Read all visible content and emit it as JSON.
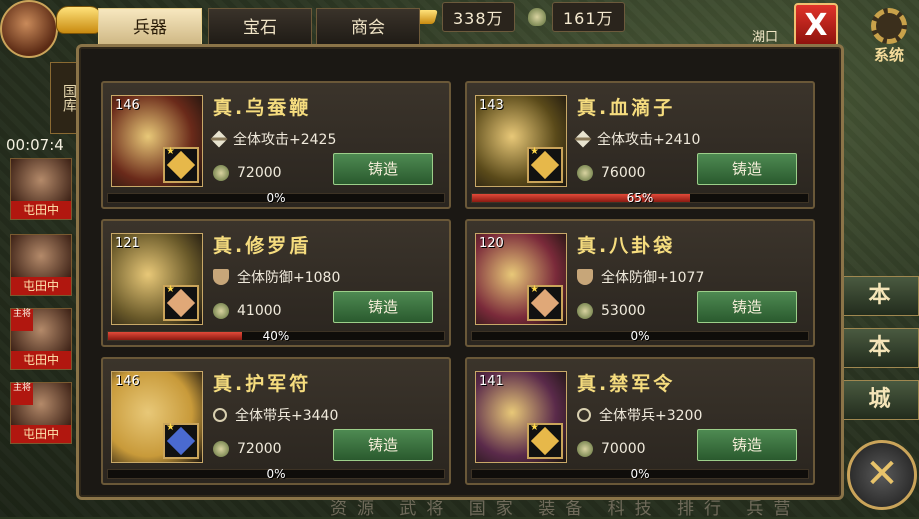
{
  "top": {
    "gold_amount": "338万",
    "money_amount": "161万",
    "city": "湖口",
    "system_label": "系统",
    "close_label": "X",
    "timer": "00:07:4"
  },
  "tabs": [
    {
      "label": "兵器",
      "active": true
    },
    {
      "label": "宝石",
      "active": false
    },
    {
      "label": "商会",
      "active": false
    }
  ],
  "left_tag": "国库",
  "heroes": [
    {
      "status": "屯田中",
      "badge": ""
    },
    {
      "status": "屯田中",
      "badge": ""
    },
    {
      "status": "屯田中",
      "badge": "主将"
    },
    {
      "status": "屯田中",
      "badge": "主将"
    }
  ],
  "right_buttons": [
    "本",
    "本",
    "城"
  ],
  "bottom_nav": "资源 武将 国家 装备 科技 排行 兵营",
  "cards": [
    {
      "level": "146",
      "name": "真.乌蚕鞭",
      "attr": "全体攻击+2425",
      "attr_icon": "sword-icon",
      "cost": "72000",
      "button": "铸造",
      "progress_label": "0%",
      "progress": 0,
      "gem_color": "#e7b84a",
      "thumb_color": "#6a2a1a"
    },
    {
      "level": "143",
      "name": "真.血滴子",
      "attr": "全体攻击+2410",
      "attr_icon": "sword-icon",
      "cost": "76000",
      "button": "铸造",
      "progress_label": "65%",
      "progress": 65,
      "gem_color": "#e7b84a",
      "thumb_color": "#5a4a1a"
    },
    {
      "level": "121",
      "name": "真.修罗盾",
      "attr": "全体防御+1080",
      "attr_icon": "shield-icon",
      "cost": "41000",
      "button": "铸造",
      "progress_label": "40%",
      "progress": 40,
      "gem_color": "#e0a878",
      "thumb_color": "#6a5a2a"
    },
    {
      "level": "120",
      "name": "真.八卦袋",
      "attr": "全体防御+1077",
      "attr_icon": "shield-icon",
      "cost": "53000",
      "button": "铸造",
      "progress_label": "0%",
      "progress": 0,
      "gem_color": "#e0a878",
      "thumb_color": "#7a2a3a"
    },
    {
      "level": "146",
      "name": "真.护军符",
      "attr": "全体带兵+3440",
      "attr_icon": "troop-icon",
      "cost": "72000",
      "button": "铸造",
      "progress_label": "0%",
      "progress": 0,
      "gem_color": "#4a6ad0",
      "thumb_color": "#c89a3a"
    },
    {
      "level": "141",
      "name": "真.禁军令",
      "attr": "全体带兵+3200",
      "attr_icon": "troop-icon",
      "cost": "70000",
      "button": "铸造",
      "progress_label": "0%",
      "progress": 0,
      "gem_color": "#e7b84a",
      "thumb_color": "#5a2a4a"
    }
  ]
}
